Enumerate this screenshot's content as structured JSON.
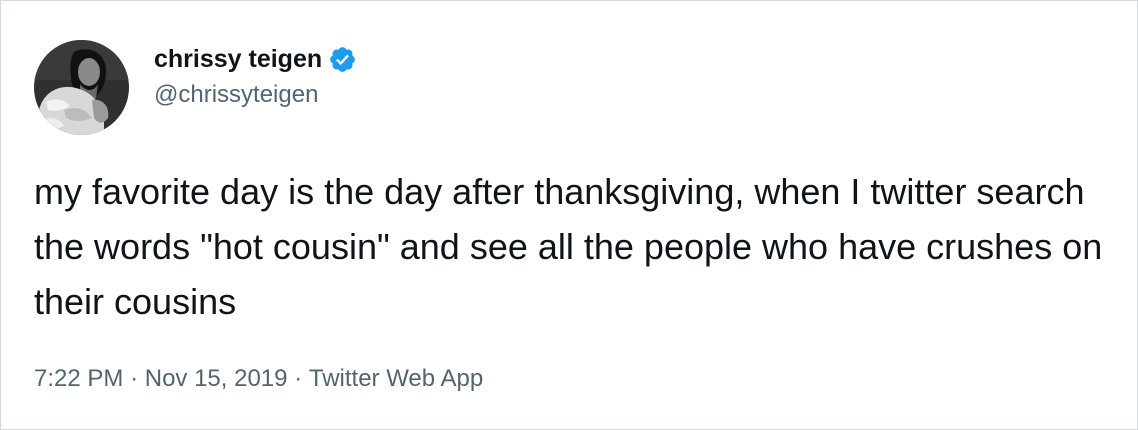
{
  "tweet": {
    "author": {
      "display_name": "chrissy teigen",
      "handle": "@chrissyteigen",
      "verified_icon": "verified-badge-icon",
      "avatar_icon": "user-avatar"
    },
    "text": "my favorite day is the day after thanksgiving, when I twitter search the words \"hot cousin\" and see all the people who have crushes on their cousins",
    "meta": {
      "time": "7:22 PM",
      "separator": "·",
      "date": "Nov 15, 2019",
      "source": "Twitter Web App"
    }
  },
  "colors": {
    "text_primary": "#0f1419",
    "text_secondary": "#536471",
    "verified_blue": "#1d9bf0",
    "border": "#cfd9de"
  }
}
